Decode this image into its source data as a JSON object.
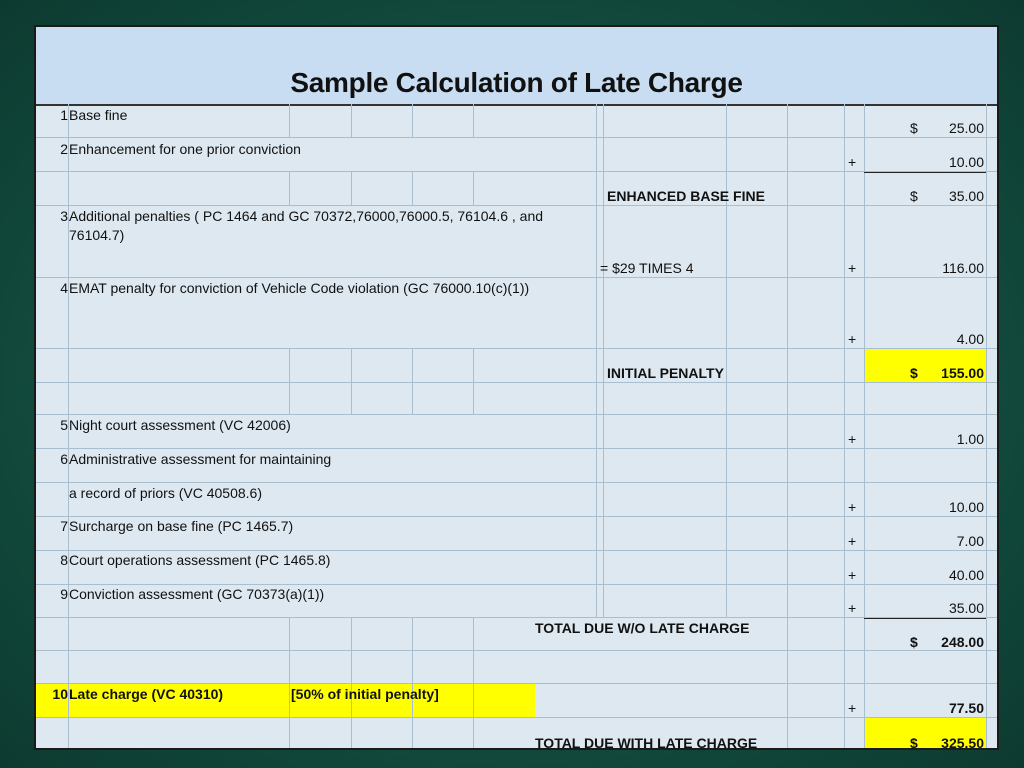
{
  "title": "Sample Calculation of Late Charge",
  "rows": [
    {
      "num": "1",
      "label": "Base fine"
    },
    {
      "num": "2",
      "label": "Enhancement for one prior conviction"
    },
    {
      "num": "3",
      "label": "Additional penalties  ( PC 1464 and GC 70372,76000,76000.5, 76104.6 , and",
      "label2": "76104.7)"
    },
    {
      "num": "4",
      "label": "EMAT penalty for conviction of Vehicle Code violation (GC 76000.10(c)(1))"
    },
    {
      "num": "5",
      "label": "Night court assessment (VC 42006)"
    },
    {
      "num": "6",
      "label": "Administrative assessment for maintaining",
      "label2": "a record of priors (VC 40508.6)"
    },
    {
      "num": "7",
      "label": "Surcharge on base fine (PC 1465.7)"
    },
    {
      "num": "8",
      "label": "Court operations assessment (PC 1465.8)"
    },
    {
      "num": "9",
      "label": "Conviction assessment (GC 70373(a)(1))"
    },
    {
      "num": "10",
      "label": "Late charge (VC 40310)",
      "note": "[50% of initial penalty]"
    }
  ],
  "amounts": {
    "base_fine": "25.00",
    "enhancement": "10.00",
    "enhanced_base_fine": "35.00",
    "additional_penalties": "116.00",
    "emat": "4.00",
    "initial_penalty": "155.00",
    "night_court": "1.00",
    "admin_assessment": "10.00",
    "surcharge": "7.00",
    "court_ops": "40.00",
    "conviction": "35.00",
    "total_wo_late": "248.00",
    "late_charge": "77.50",
    "total_with_late": "325.50"
  },
  "labels": {
    "enhanced_base_fine": "ENHANCED BASE FINE",
    "times": "= $29 TIMES 4",
    "initial_penalty": "INITIAL PENALTY",
    "total_wo_late": "TOTAL DUE W/O LATE CHARGE",
    "total_with_late": "TOTAL DUE WITH LATE CHARGE"
  },
  "symbols": {
    "dollar": "$",
    "plus": "+"
  },
  "colors": {
    "highlight": "#ffff00",
    "title_band": "#c8dcf2",
    "sheet": "#dde8f0"
  }
}
